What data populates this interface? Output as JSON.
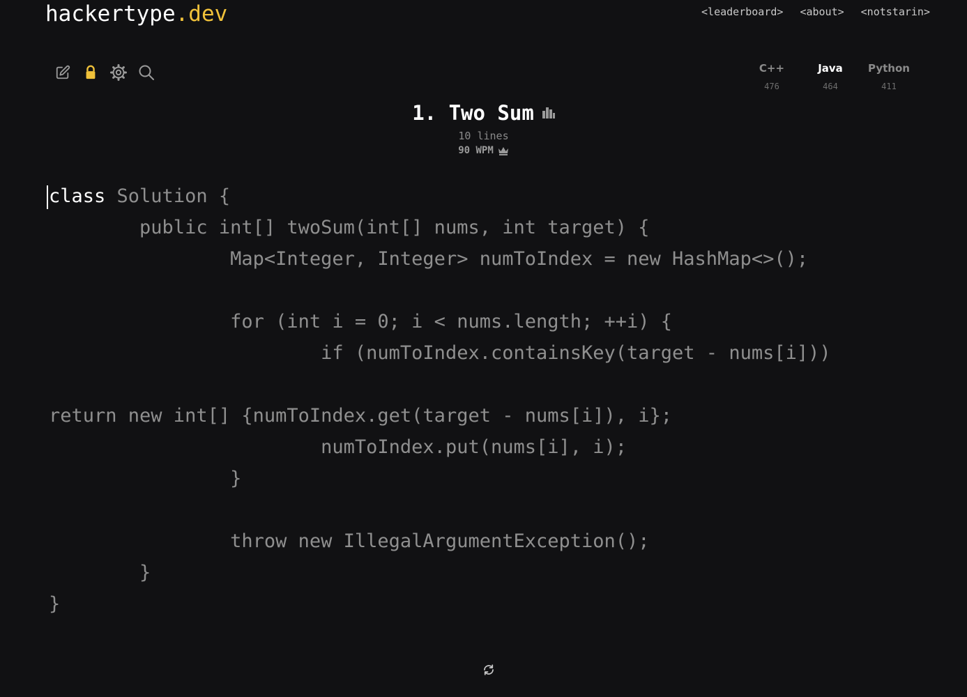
{
  "brand": {
    "name": "hackertype",
    "tld": ".dev"
  },
  "nav": [
    {
      "label": "<leaderboard>"
    },
    {
      "label": "<about>"
    },
    {
      "label": "<notstarin>"
    }
  ],
  "toolbar": {
    "icons": [
      "edit-icon",
      "lock-icon",
      "settings-icon",
      "search-icon"
    ]
  },
  "languages": [
    {
      "name": "C++",
      "count": "476",
      "active": false
    },
    {
      "name": "Java",
      "count": "464",
      "active": true
    },
    {
      "name": "Python",
      "count": "411",
      "active": false
    }
  ],
  "problem": {
    "title": "1. Two Sum",
    "lines": "10 lines",
    "wpm": "90 WPM"
  },
  "code": {
    "typed": "",
    "lines": [
      "class Solution {",
      "        public int[] twoSum(int[] nums, int target) {",
      "                Map<Integer, Integer> numToIndex = new HashMap<>();",
      "",
      "                for (int i = 0; i < nums.length; ++i) {",
      "                        if (numToIndex.containsKey(target - nums[i]))",
      "",
      "return new int[] {numToIndex.get(target - nums[i]), i};",
      "                        numToIndex.put(nums[i], i);",
      "                }",
      "",
      "                throw new IllegalArgumentException();",
      "        }",
      "}"
    ]
  },
  "colors": {
    "background": "#111113",
    "accent": "#f0c13a",
    "code_untyped": "#8f8f8f",
    "code_typed": "#ffffff"
  }
}
